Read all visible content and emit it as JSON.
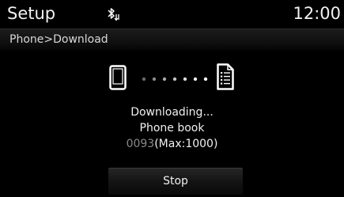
{
  "header": {
    "title": "Setup",
    "clock": "12:00",
    "status_icon": "bluetooth-phonebook-download-icon"
  },
  "breadcrumb": "Phone>Download",
  "progress": {
    "source_icon": "phone-icon",
    "target_icon": "phonebook-document-icon",
    "line1": "Downloading...",
    "line2": "Phone book",
    "count": "0093",
    "max": "(Max:1000)"
  },
  "stop_label": "Stop",
  "colors": {
    "background": "#000000",
    "text": "#f0f0f0",
    "count_text": "#8a8a8a"
  }
}
